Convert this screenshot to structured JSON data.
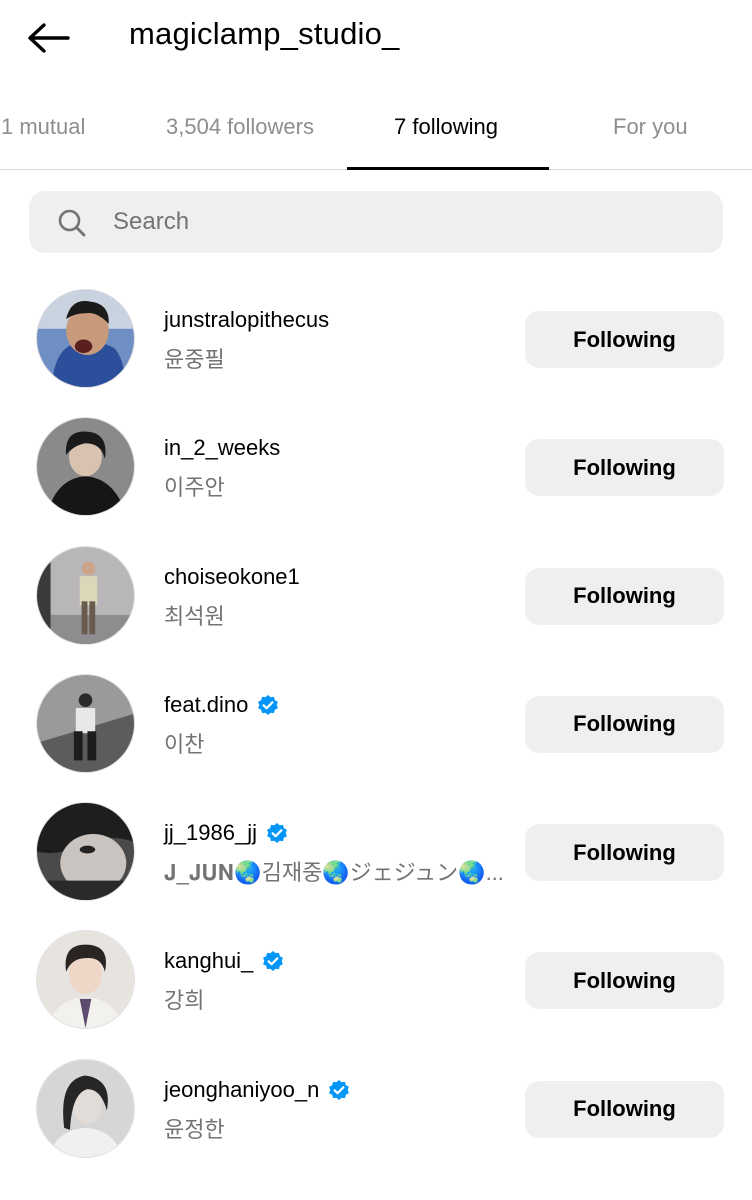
{
  "header": {
    "title": "magiclamp_studio_",
    "back_icon": "arrow-left-icon"
  },
  "tabs": [
    {
      "label": "1 mutual"
    },
    {
      "label": "3,504 followers"
    },
    {
      "label": "7 following",
      "active": true
    },
    {
      "label": "For you"
    }
  ],
  "search": {
    "placeholder": "Search",
    "value": "",
    "icon": "search-icon"
  },
  "colors": {
    "button_bg": "#efefef",
    "secondary_text": "#737373",
    "tab_inactive": "#8e8e8e",
    "verified": "#0095f6"
  },
  "accounts": [
    {
      "username": "junstralopithecus",
      "name": "윤중필",
      "verified": false,
      "button": "Following"
    },
    {
      "username": "in_2_weeks",
      "name": "이주안",
      "verified": false,
      "button": "Following"
    },
    {
      "username": "choiseokone1",
      "name": "최석원",
      "verified": false,
      "button": "Following"
    },
    {
      "username": "feat.dino",
      "name": "이찬",
      "verified": true,
      "button": "Following"
    },
    {
      "username": "jj_1986_jj",
      "name": "𝐉_𝐉𝐔𝐍🌏김재중🌏ジェジュン🌏...",
      "verified": true,
      "button": "Following"
    },
    {
      "username": "kanghui_",
      "name": "강희",
      "verified": true,
      "button": "Following"
    },
    {
      "username": "jeonghaniyoo_n",
      "name": "윤정한",
      "verified": true,
      "button": "Following"
    }
  ]
}
